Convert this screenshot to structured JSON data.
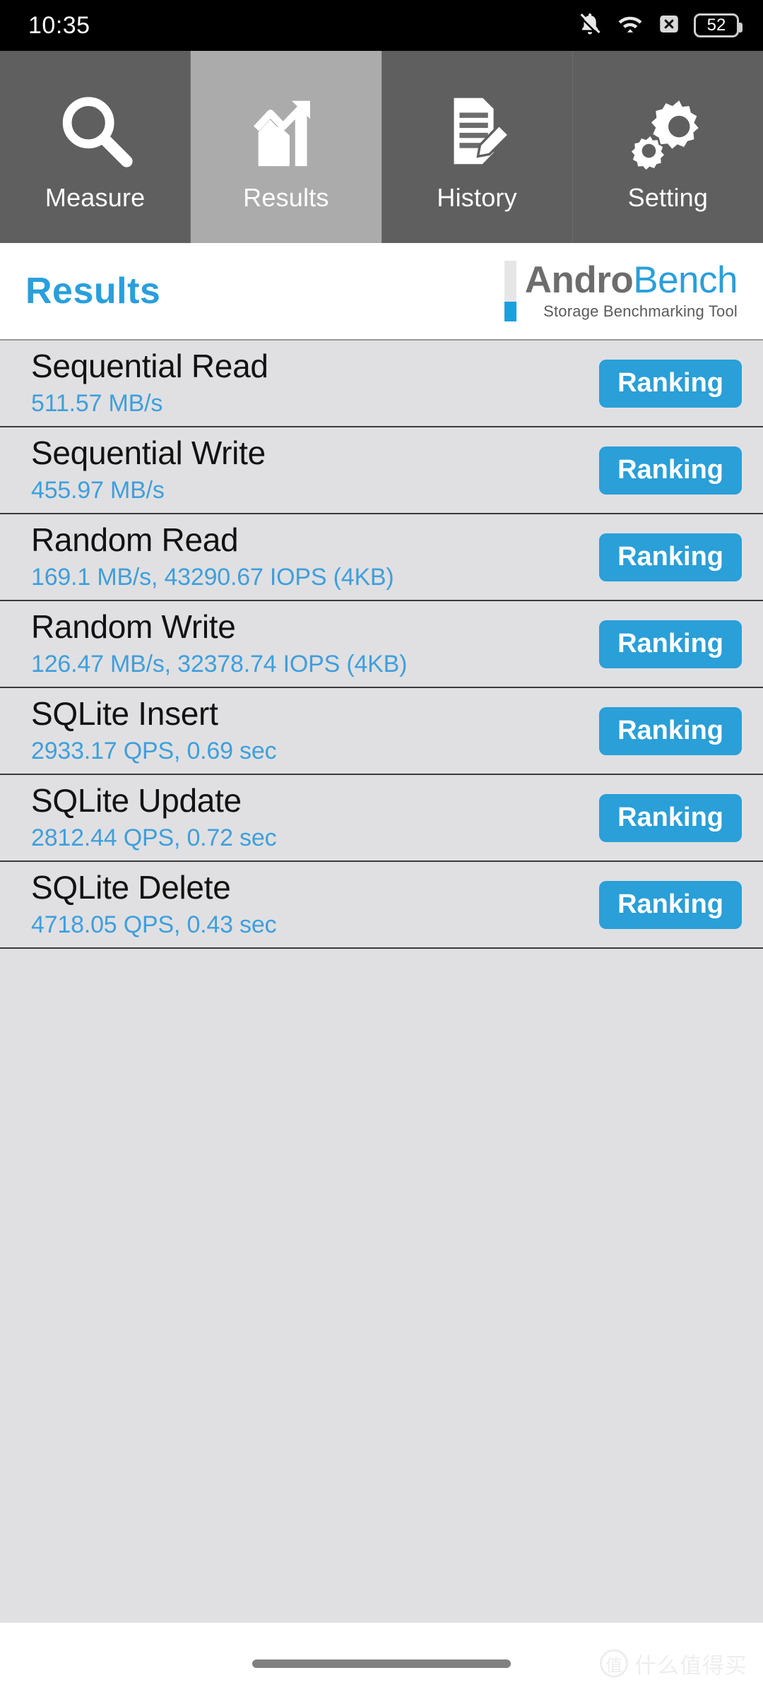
{
  "status_bar": {
    "time": "10:35",
    "battery_level": "52",
    "icons": [
      "bell-mute-icon",
      "wifi-icon",
      "signal-x-icon",
      "battery-icon"
    ]
  },
  "tabs": [
    {
      "label": "Measure",
      "icon": "magnifier-icon",
      "active": false
    },
    {
      "label": "Results",
      "icon": "bar-chart-arrow-icon",
      "active": true
    },
    {
      "label": "History",
      "icon": "document-pencil-icon",
      "active": false
    },
    {
      "label": "Setting",
      "icon": "gears-icon",
      "active": false
    }
  ],
  "header": {
    "page_title": "Results",
    "logo": {
      "word_1": "Andro",
      "word_2": "Bench",
      "subtitle": "Storage Benchmarking Tool"
    }
  },
  "results": [
    {
      "name": "Sequential Read",
      "value": "511.57 MB/s",
      "button": "Ranking"
    },
    {
      "name": "Sequential Write",
      "value": "455.97 MB/s",
      "button": "Ranking"
    },
    {
      "name": "Random Read",
      "value": "169.1 MB/s, 43290.67 IOPS (4KB)",
      "button": "Ranking"
    },
    {
      "name": "Random Write",
      "value": "126.47 MB/s, 32378.74 IOPS (4KB)",
      "button": "Ranking"
    },
    {
      "name": "SQLite Insert",
      "value": "2933.17 QPS, 0.69 sec",
      "button": "Ranking"
    },
    {
      "name": "SQLite Update",
      "value": "2812.44 QPS, 0.72 sec",
      "button": "Ranking"
    },
    {
      "name": "SQLite Delete",
      "value": "4718.05 QPS, 0.43 sec",
      "button": "Ranking"
    }
  ],
  "watermark": {
    "logo_char": "值",
    "text": "什么值得买"
  },
  "colors": {
    "accent_blue": "#2a9fdc",
    "value_blue": "#3f9fdc",
    "tab_inactive": "#5f5f5f",
    "tab_active": "#ababab",
    "list_bg": "#e0e0e2",
    "statusbar_bg": "#000000"
  }
}
